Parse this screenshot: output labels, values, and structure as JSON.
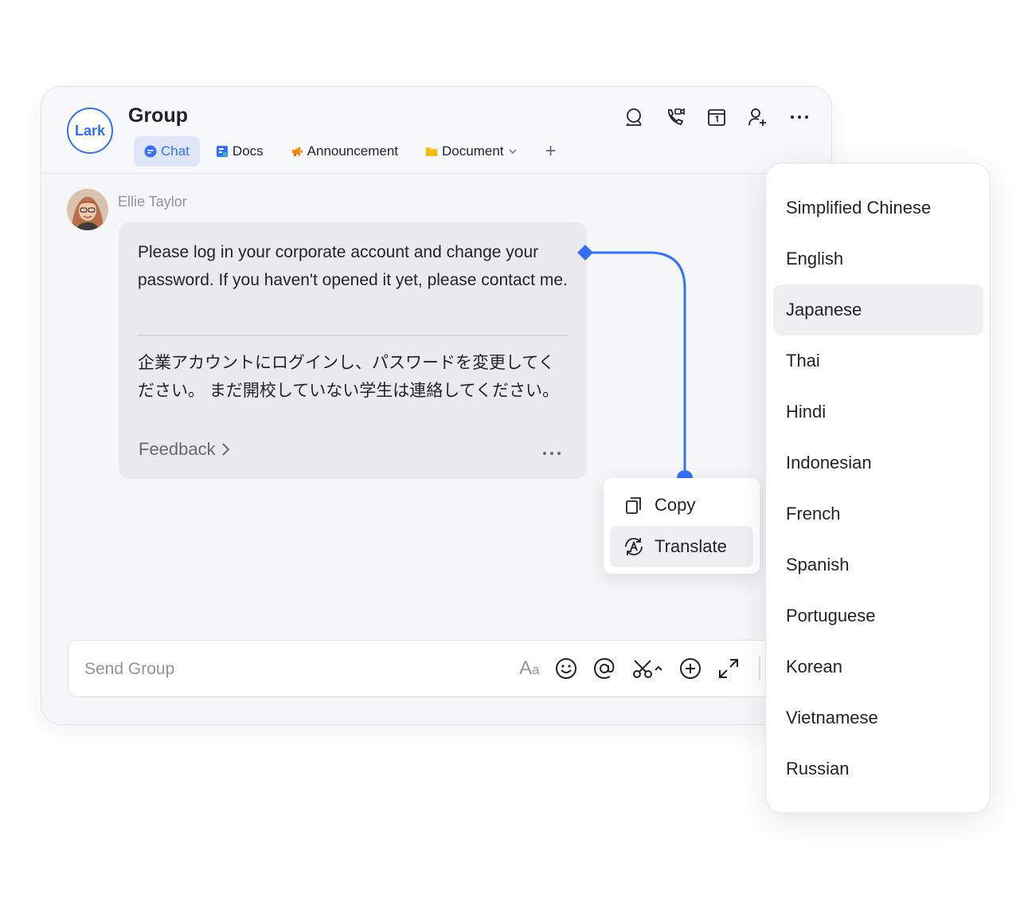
{
  "app": {
    "logo_text": "Lark"
  },
  "header": {
    "title": "Group",
    "tabs": [
      {
        "label": "Chat",
        "icon": "chat-bubble-icon",
        "active": true
      },
      {
        "label": "Docs",
        "icon": "docs-icon",
        "active": false
      },
      {
        "label": "Announcement",
        "icon": "megaphone-icon",
        "active": false
      },
      {
        "label": "Document",
        "icon": "folder-icon",
        "active": false,
        "has_dropdown": true
      }
    ],
    "add_tab_label": "+",
    "tools": [
      "search-icon",
      "video-call-icon",
      "calendar-icon",
      "add-member-icon",
      "more-icon"
    ]
  },
  "message": {
    "sender": "Ellie Taylor",
    "text_original": "Please log in your corporate account and change your password. If you haven't opened it yet, please contact me.",
    "text_translated": "企業アカウントにログインし、パスワードを変更してください。 まだ開校していない学生は連絡してください。",
    "feedback_label": "Feedback"
  },
  "context_menu": {
    "items": [
      {
        "label": "Copy",
        "icon": "copy-icon"
      },
      {
        "label": "Translate",
        "icon": "translate-icon",
        "selected": true
      }
    ]
  },
  "language_menu": {
    "items": [
      "Simplified Chinese",
      "English",
      "Japanese",
      "Thai",
      "Hindi",
      "Indonesian",
      "French",
      "Spanish",
      "Portuguese",
      "Korean",
      "Vietnamese",
      "Russian"
    ],
    "selected": "Japanese"
  },
  "composer": {
    "placeholder": "Send Group",
    "font_button": {
      "big": "A",
      "small": "a"
    },
    "tools": [
      "font-format-icon",
      "emoji-icon",
      "mention-icon",
      "scissors-icon",
      "plus-circle-icon",
      "expand-icon"
    ]
  },
  "colors": {
    "accent": "#3370ff",
    "bubble_bg": "#e9eaed",
    "window_bg": "#f5f6f8",
    "active_tab_bg": "#dfe6f9",
    "selected_item_bg": "#eeeff1",
    "announcement_orange": "#ff8800",
    "folder_yellow": "#ffc60a"
  }
}
